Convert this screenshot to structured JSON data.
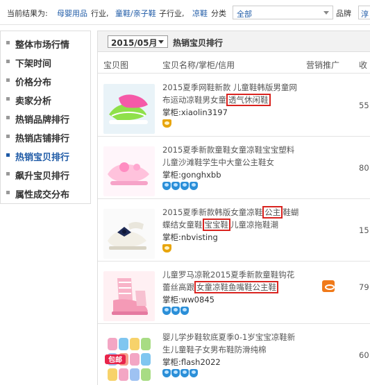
{
  "filter": {
    "prefix": "当前结果为:",
    "level1": "母婴用品",
    "level1_suffix": "行业,",
    "level2": "童鞋/亲子鞋",
    "level2_suffix": "子行业,",
    "level3": "凉鞋",
    "level3_suffix": "分类",
    "category_select": "全部",
    "brand_label": "品牌",
    "brand_select": "淳"
  },
  "sidebar": {
    "items": [
      {
        "label": "整体市场行情",
        "active": false
      },
      {
        "label": "下架时间",
        "active": false
      },
      {
        "label": "价格分布",
        "active": false
      },
      {
        "label": "卖家分析",
        "active": false
      },
      {
        "label": "热销品牌排行",
        "active": false
      },
      {
        "label": "热销店铺排行",
        "active": false
      },
      {
        "label": "热销宝贝排行",
        "active": true
      },
      {
        "label": "飙升宝贝排行",
        "active": false
      },
      {
        "label": "属性成交分布",
        "active": false
      }
    ]
  },
  "panel": {
    "month": "2015/05月",
    "title": "热销宝贝排行",
    "columns": {
      "image": "宝贝图",
      "name": "宝贝名称/掌柜/信用",
      "promo": "营销推广",
      "sales": "收"
    }
  },
  "rows": [
    {
      "title_parts": [
        "2015夏季网鞋新款 儿童鞋韩版男童网布运动凉鞋男女童",
        "透气休闲鞋",
        ""
      ],
      "seller_label": "掌柜:",
      "seller": "xiaolin3197",
      "credit": "crown",
      "credit_count": 1,
      "sales": "55",
      "promo": false
    },
    {
      "title_parts": [
        "2015夏季新款童鞋女童凉鞋宝宝塑料儿童沙滩鞋学生中大童公主鞋女",
        "",
        ""
      ],
      "seller_label": "掌柜:",
      "seller": "gonghxbb",
      "credit": "diamond",
      "credit_count": 4,
      "sales": "80",
      "promo": false
    },
    {
      "title_parts": [
        "2015夏季新款韩版女童凉鞋",
        "公主",
        "鞋蝴蝶结女童鞋",
        "宝宝鞋",
        "儿童凉拖鞋潮"
      ],
      "seller_label": "掌柜:",
      "seller": "nbvisting",
      "credit": "crown",
      "credit_count": 1,
      "sales": "15",
      "promo": false
    },
    {
      "title_parts": [
        "儿童罗马凉靴2015夏季新款童鞋钩花蕾丝高跟",
        "女童凉鞋鱼嘴鞋公主鞋",
        ""
      ],
      "seller_label": "掌柜:",
      "seller": "ww0845",
      "credit": "diamond",
      "credit_count": 3,
      "sales": "79",
      "promo": true
    },
    {
      "title_parts": [
        "婴儿学步鞋软底夏季0-1岁宝宝凉鞋新生儿童鞋子女男布鞋防滑纯棉",
        "",
        ""
      ],
      "seller_label": "掌柜:",
      "seller": "flash2022",
      "credit": "diamond",
      "credit_count": 4,
      "sales": "60",
      "promo": false
    }
  ],
  "thumb_label_row5": "包邮",
  "colors": {
    "link": "#1e5aa6",
    "highlight_box": "#d9231f",
    "crown": "#e8a50c",
    "diamond": "#2b8fd8"
  }
}
